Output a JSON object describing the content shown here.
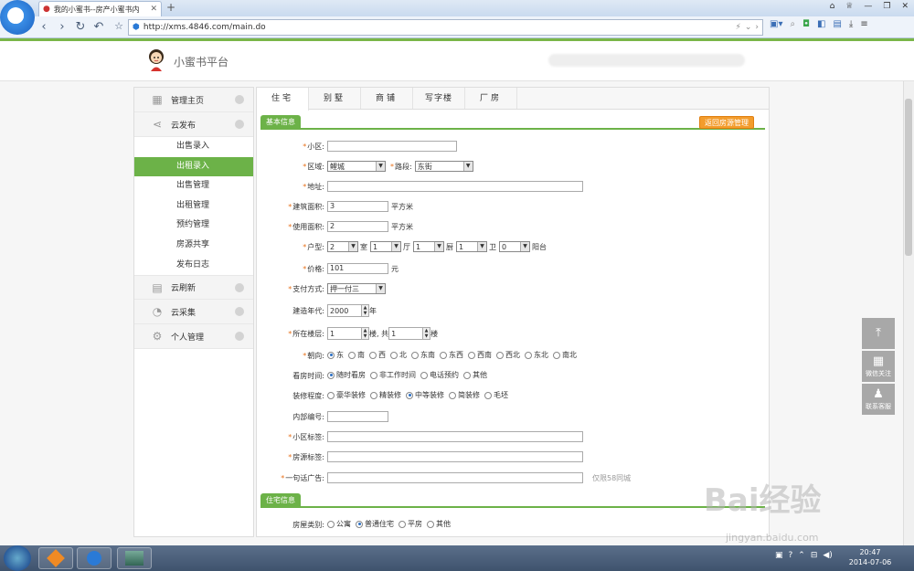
{
  "browser": {
    "tab_title": "我的小蜜书--房产小蜜书内",
    "new_tab": "+",
    "url": "http://xms.4846.com/main.do"
  },
  "site": {
    "title": "小蜜书平台"
  },
  "sidebar": {
    "main_items": [
      {
        "label": "管理主页",
        "icon": "home-icon"
      },
      {
        "label": "云发布",
        "icon": "share-icon"
      }
    ],
    "sub_items": [
      "出售录入",
      "出租录入",
      "出售管理",
      "出租管理",
      "预约管理",
      "房源共享",
      "发布日志"
    ],
    "active_sub": "出租录入",
    "bottom_items": [
      {
        "label": "云刷新",
        "icon": "printer-icon"
      },
      {
        "label": "云采集",
        "icon": "pie-icon"
      },
      {
        "label": "个人管理",
        "icon": "gear-icon"
      }
    ]
  },
  "tabs": [
    "住宅",
    "别墅",
    "商铺",
    "写字楼",
    "厂房"
  ],
  "sections": {
    "basic": "基本信息",
    "house": "住宅信息",
    "back_button": "返回房源管理"
  },
  "form": {
    "community": {
      "label": "小区:",
      "value": ""
    },
    "district": {
      "label": "区域:",
      "value": "鲤城"
    },
    "road": {
      "label": "路段:",
      "value": "东街"
    },
    "address": {
      "label": "地址:",
      "value": ""
    },
    "built_area": {
      "label": "建筑面积:",
      "value": "3",
      "unit": "平方米"
    },
    "use_area": {
      "label": "使用面积:",
      "value": "2",
      "unit": "平方米"
    },
    "layout": {
      "label": "户型:",
      "room": "2",
      "room_unit": "室",
      "hall": "1",
      "hall_unit": "厅",
      "kitchen": "1",
      "kitchen_unit": "厨",
      "bath": "1",
      "bath_unit": "卫",
      "balcony": "0",
      "balcony_unit": "阳台"
    },
    "price": {
      "label": "价格:",
      "value": "101",
      "unit": "元"
    },
    "payment": {
      "label": "支付方式:",
      "value": "押一付三"
    },
    "year": {
      "label": "建造年代:",
      "value": "2000",
      "unit": "年"
    },
    "floor": {
      "label": "所在楼层:",
      "value": "1",
      "mid": "楼, 共",
      "total": "1",
      "unit": "楼"
    },
    "orientation": {
      "label": "朝向:",
      "options": [
        "东",
        "南",
        "西",
        "北",
        "东南",
        "东西",
        "西南",
        "西北",
        "东北",
        "南北"
      ],
      "selected": 0
    },
    "viewing": {
      "label": "看房时间:",
      "options": [
        "随时看房",
        "非工作时间",
        "电话预约",
        "其他"
      ],
      "selected": 0
    },
    "decoration": {
      "label": "装修程度:",
      "options": [
        "豪华装修",
        "精装修",
        "中等装修",
        "简装修",
        "毛坯"
      ],
      "selected": 2
    },
    "internal_no": {
      "label": "内部编号:",
      "value": ""
    },
    "community_tag": {
      "label": "小区标签:",
      "value": ""
    },
    "house_tag": {
      "label": "房源标签:",
      "value": ""
    },
    "ad": {
      "label": "一句话广告:",
      "value": "",
      "note": "仅限58同城"
    },
    "house_type": {
      "label": "房屋类别:",
      "options": [
        "公寓",
        "普通住宅",
        "平房",
        "其他"
      ],
      "selected": 1
    }
  },
  "float_panel": {
    "wechat": "微信关注",
    "service": "联系客服"
  },
  "watermark": {
    "brand": "Bai经验",
    "url": "jingyan.baidu.com"
  },
  "taskbar": {
    "time": "20:47",
    "date": "2014-07-06"
  }
}
